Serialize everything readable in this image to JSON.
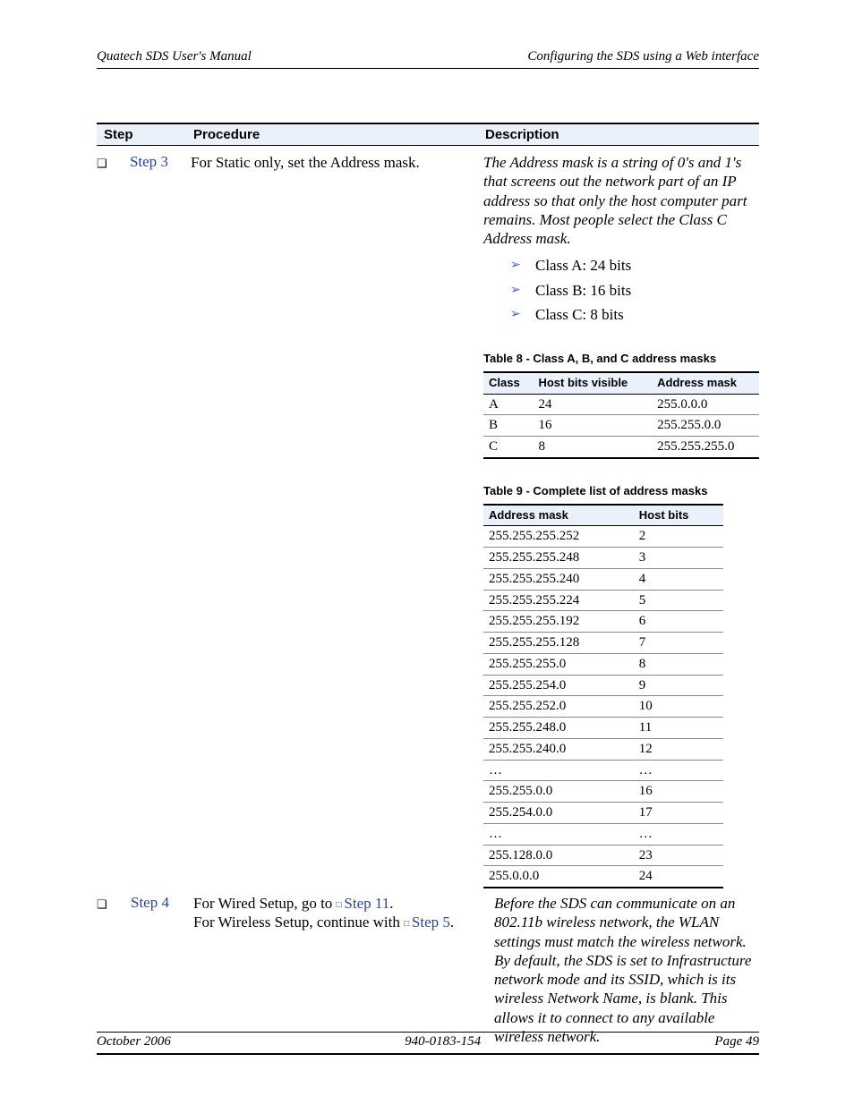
{
  "header": {
    "left": "Quatech SDS User's Manual",
    "right": "Configuring the SDS using a Web interface"
  },
  "mainHead": {
    "step": "Step",
    "proc": "Procedure",
    "desc": "Description"
  },
  "step3": {
    "label": "Step 3",
    "proc": "For Static only, set the Address mask.",
    "desc": "The Address mask is a string of 0's and 1's that screens out the network part of an IP address so that only the host computer part remains. Most people select the Class C Address mask.",
    "bullets": [
      "Class A: 24 bits",
      "Class B: 16 bits",
      "Class C: 8 bits"
    ]
  },
  "table8": {
    "caption": "Table 8 - Class A, B, and C address masks",
    "head": [
      "Class",
      "Host bits visible",
      "Address mask"
    ],
    "rows": [
      [
        "A",
        "24",
        "255.0.0.0"
      ],
      [
        "B",
        "16",
        "255.255.0.0"
      ],
      [
        "C",
        "8",
        "255.255.255.0"
      ]
    ]
  },
  "table9": {
    "caption": "Table 9 - Complete list of address masks",
    "head": [
      "Address mask",
      "Host bits"
    ],
    "rows": [
      [
        "255.255.255.252",
        "2"
      ],
      [
        "255.255.255.248",
        "3"
      ],
      [
        "255.255.255.240",
        "4"
      ],
      [
        "255.255.255.224",
        "5"
      ],
      [
        "255.255.255.192",
        "6"
      ],
      [
        "255.255.255.128",
        "7"
      ],
      [
        "255.255.255.0",
        "8"
      ],
      [
        "255.255.254.0",
        "9"
      ],
      [
        "255.255.252.0",
        "10"
      ],
      [
        "255.255.248.0",
        "11"
      ],
      [
        "255.255.240.0",
        "12"
      ],
      [
        "…",
        "…"
      ],
      [
        "255.255.0.0",
        "16"
      ],
      [
        "255.254.0.0",
        "17"
      ],
      [
        "…",
        "…"
      ],
      [
        "255.128.0.0",
        "23"
      ],
      [
        "255.0.0.0",
        "24"
      ]
    ]
  },
  "step4": {
    "label": "Step 4",
    "procA": "For Wired Setup, go to ",
    "link11": "Step 11",
    "procB": ".",
    "procC": "For Wireless Setup, continue with ",
    "link5": "Step 5",
    "procD": ".",
    "desc": "Before the SDS can communicate on an 802.11b wireless network, the WLAN settings must match the wireless network. By default, the SDS is set to Infrastructure network mode and its SSID, which is its wireless Network Name, is blank. This allows it to connect to any available wireless network."
  },
  "footer": {
    "left": "October 2006",
    "mid": "940-0183-154",
    "right": "Page 49"
  }
}
